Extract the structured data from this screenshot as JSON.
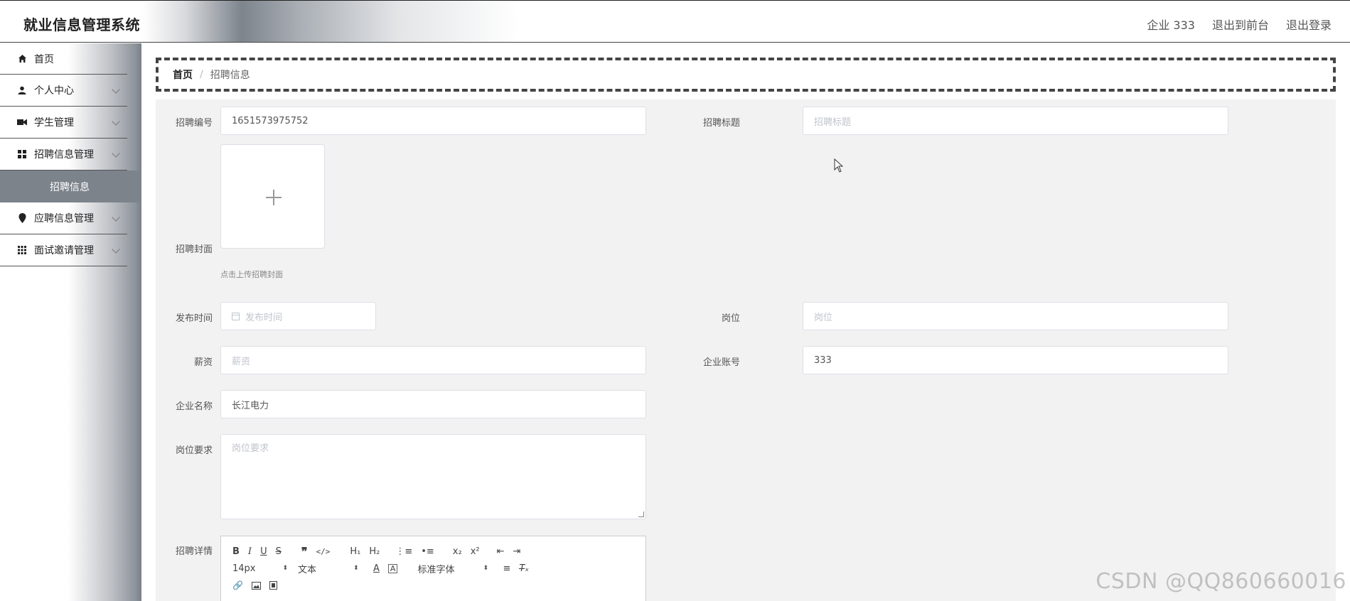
{
  "header": {
    "title": "就业信息管理系统",
    "nav": [
      "企业 333",
      "退出到前台",
      "退出登录"
    ]
  },
  "sidebar": {
    "items": [
      {
        "label": "首页",
        "icon": "home-icon"
      },
      {
        "label": "个人中心",
        "icon": "user-icon"
      },
      {
        "label": "学生管理",
        "icon": "video-icon"
      },
      {
        "label": "招聘信息管理",
        "icon": "grid-icon",
        "sub": "招聘信息"
      },
      {
        "label": "应聘信息管理",
        "icon": "location-icon"
      },
      {
        "label": "面试邀请管理",
        "icon": "apps-icon"
      }
    ]
  },
  "breadcrumb": {
    "home": "首页",
    "separator": "/",
    "current": "招聘信息"
  },
  "form": {
    "recruit_no": {
      "label": "招聘编号",
      "value": "1651573975752"
    },
    "recruit_title": {
      "label": "招聘标题",
      "placeholder": "招聘标题"
    },
    "cover": {
      "label": "招聘封面",
      "tip": "点击上传招聘封面"
    },
    "publish_time": {
      "label": "发布时间",
      "placeholder": "发布时间"
    },
    "position": {
      "label": "岗位",
      "placeholder": "岗位"
    },
    "salary": {
      "label": "薪资",
      "placeholder": "薪资"
    },
    "company_account": {
      "label": "企业账号",
      "value": "333"
    },
    "company_name": {
      "label": "企业名称",
      "value": "长江电力"
    },
    "requirements": {
      "label": "岗位要求",
      "placeholder": "岗位要求"
    },
    "details": {
      "label": "招聘详情"
    }
  },
  "editor": {
    "font_size": "14px",
    "header_select": "文本",
    "font_family": "标准字体"
  },
  "watermark": "CSDN @QQ860660016"
}
